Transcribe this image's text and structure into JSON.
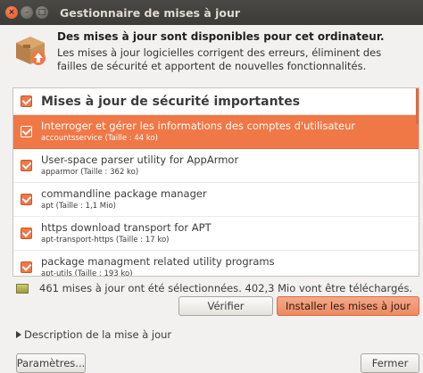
{
  "window": {
    "title": "Gestionnaire de mises à jour",
    "close_glyph": "×",
    "minimize_glyph": "–",
    "maximize_glyph": "□"
  },
  "header": {
    "title": "Des mises à jour sont disponibles pour cet ordinateur.",
    "description": "Les mises à jour logicielles corrigent des erreurs, éliminent des failles de sécurité et apportent de nouvelles fonctionnalités.",
    "icon": "package-update-icon"
  },
  "updates": {
    "group_label": "Mises à jour de sécurité importantes",
    "items": [
      {
        "name": "Interroger et gérer les informations des comptes d'utilisateur",
        "detail": "accountsservice (Taille : 44 ko)"
      },
      {
        "name": "User-space parser utility for AppArmor",
        "detail": "apparmor (Taille : 362 ko)"
      },
      {
        "name": "commandline package manager",
        "detail": "apt (Taille : 1,1 Mio)"
      },
      {
        "name": "https download transport for APT",
        "detail": "apt-transport-https (Taille : 17 ko)"
      },
      {
        "name": "package managment related utility programs",
        "detail": "apt-utils (Taille : 193 ko)"
      }
    ]
  },
  "status": {
    "text": "461 mises à jour ont été sélectionnées. 402,3 Mio vont être téléchargés.",
    "icon": "download-icon"
  },
  "buttons": {
    "check": "Vérifier",
    "install": "Installer les mises à jour",
    "settings": "Paramètres...",
    "close": "Fermer"
  },
  "expander": {
    "label": "Description de la mise à jour"
  },
  "colors": {
    "accent": "#f07746",
    "titlebar": "#3c3b37"
  }
}
